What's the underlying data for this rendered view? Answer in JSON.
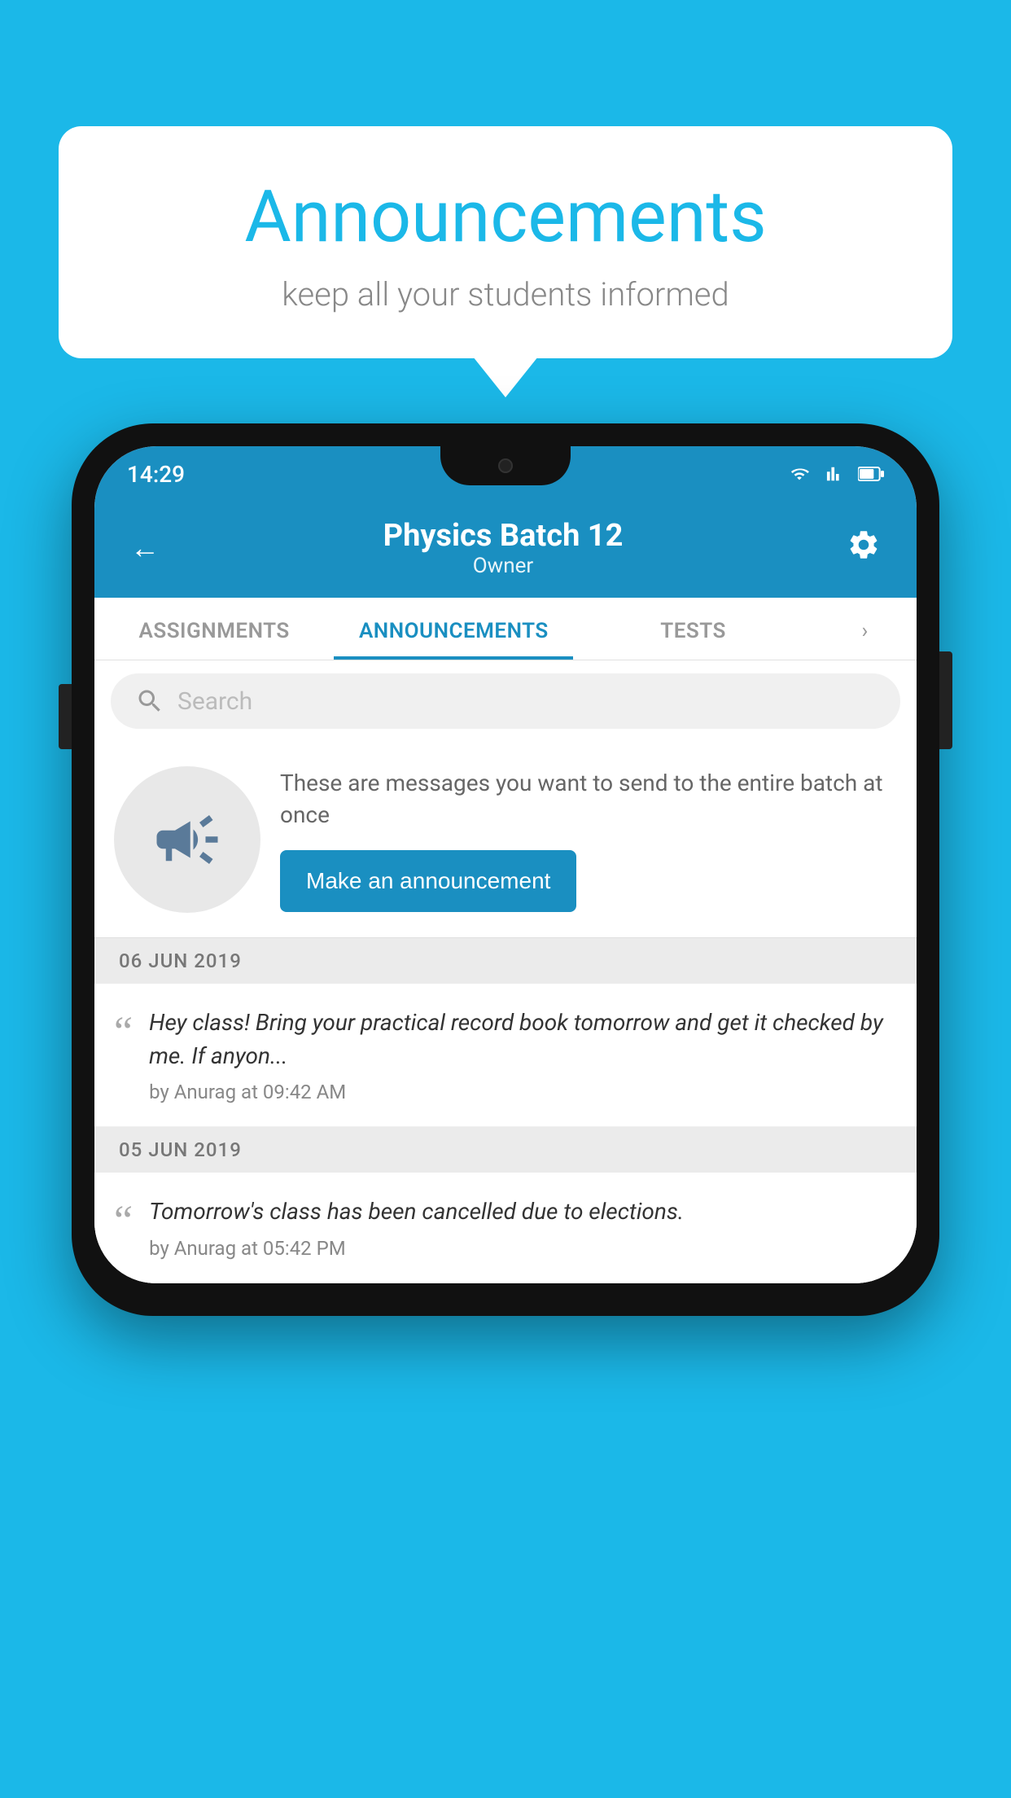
{
  "bubble": {
    "title": "Announcements",
    "subtitle": "keep all your students informed"
  },
  "statusBar": {
    "time": "14:29"
  },
  "appBar": {
    "title": "Physics Batch 12",
    "subtitle": "Owner",
    "backLabel": "←",
    "settingsLabel": "⚙"
  },
  "tabs": [
    {
      "label": "ASSIGNMENTS",
      "active": false
    },
    {
      "label": "ANNOUNCEMENTS",
      "active": true
    },
    {
      "label": "TESTS",
      "active": false
    }
  ],
  "search": {
    "placeholder": "Search"
  },
  "promo": {
    "text": "These are messages you want to send to the entire batch at once",
    "buttonLabel": "Make an announcement"
  },
  "dateDividers": [
    {
      "label": "06  JUN  2019"
    },
    {
      "label": "05  JUN  2019"
    }
  ],
  "announcements": [
    {
      "text": "Hey class! Bring your practical record book tomorrow and get it checked by me. If anyon...",
      "meta": "by Anurag at 09:42 AM"
    },
    {
      "text": "Tomorrow's class has been cancelled due to elections.",
      "meta": "by Anurag at 05:42 PM"
    }
  ]
}
